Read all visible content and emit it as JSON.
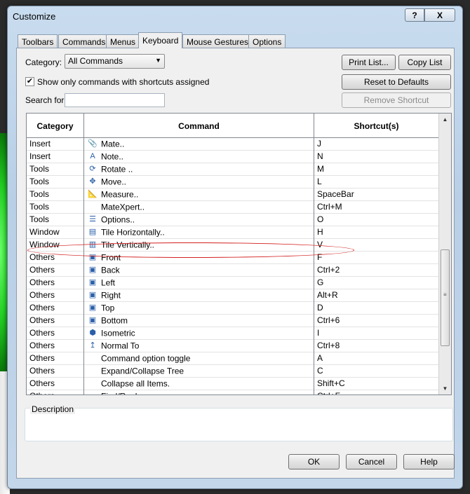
{
  "window": {
    "title": "Customize",
    "help_glyph": "?",
    "close_glyph": "X"
  },
  "tabs": [
    {
      "label": "Toolbars"
    },
    {
      "label": "Commands"
    },
    {
      "label": "Menus"
    },
    {
      "label": "Keyboard"
    },
    {
      "label": "Mouse Gestures"
    },
    {
      "label": "Options"
    }
  ],
  "active_tab": "Keyboard",
  "category": {
    "label": "Category:",
    "value": "All Commands"
  },
  "show_only": {
    "checked": true,
    "label": "Show only commands with shortcuts assigned"
  },
  "search": {
    "label": "Search for:",
    "value": ""
  },
  "buttons": {
    "print_list": "Print List...",
    "copy_list": "Copy List",
    "reset_defaults": "Reset to Defaults",
    "remove_shortcut": "Remove Shortcut",
    "ok": "OK",
    "cancel": "Cancel",
    "help": "Help"
  },
  "table": {
    "headers": [
      "Category",
      "Command",
      "Shortcut(s)"
    ],
    "rows": [
      {
        "category": "Insert",
        "icon": "paperclip-icon",
        "glyph": "📎",
        "command": "Mate..",
        "shortcut": "J"
      },
      {
        "category": "Insert",
        "icon": "note-icon",
        "glyph": "A",
        "command": "Note..",
        "shortcut": "N"
      },
      {
        "category": "Tools",
        "icon": "rotate-icon",
        "glyph": "⟳",
        "command": "Rotate ..",
        "shortcut": "M"
      },
      {
        "category": "Tools",
        "icon": "move-icon",
        "glyph": "✥",
        "command": "Move..",
        "shortcut": "L"
      },
      {
        "category": "Tools",
        "icon": "measure-icon",
        "glyph": "📐",
        "command": "Measure..",
        "shortcut": "SpaceBar"
      },
      {
        "category": "Tools",
        "icon": "",
        "glyph": "",
        "command": "MateXpert..",
        "shortcut": "Ctrl+M"
      },
      {
        "category": "Tools",
        "icon": "options-icon",
        "glyph": "☰",
        "command": "Options..",
        "shortcut": "O"
      },
      {
        "category": "Window",
        "icon": "tile-horizontal-icon",
        "glyph": "▤",
        "command": "Tile Horizontally..",
        "shortcut": "H"
      },
      {
        "category": "Window",
        "icon": "tile-vertical-icon",
        "glyph": "▥",
        "command": "Tile Vertically..",
        "shortcut": "V"
      },
      {
        "category": "Others",
        "icon": "front-view-icon",
        "glyph": "▣",
        "command": "Front",
        "shortcut": "F"
      },
      {
        "category": "Others",
        "icon": "back-view-icon",
        "glyph": "▣",
        "command": "Back",
        "shortcut": "Ctrl+2"
      },
      {
        "category": "Others",
        "icon": "left-view-icon",
        "glyph": "▣",
        "command": "Left",
        "shortcut": "G"
      },
      {
        "category": "Others",
        "icon": "right-view-icon",
        "glyph": "▣",
        "command": "Right",
        "shortcut": "Alt+R"
      },
      {
        "category": "Others",
        "icon": "top-view-icon",
        "glyph": "▣",
        "command": "Top",
        "shortcut": "D"
      },
      {
        "category": "Others",
        "icon": "bottom-view-icon",
        "glyph": "▣",
        "command": "Bottom",
        "shortcut": "Ctrl+6"
      },
      {
        "category": "Others",
        "icon": "isometric-view-icon",
        "glyph": "⬢",
        "command": "Isometric",
        "shortcut": "I"
      },
      {
        "category": "Others",
        "icon": "normal-to-icon",
        "glyph": "↥",
        "command": "Normal To",
        "shortcut": "Ctrl+8"
      },
      {
        "category": "Others",
        "icon": "",
        "glyph": "",
        "command": "Command option toggle",
        "shortcut": "A"
      },
      {
        "category": "Others",
        "icon": "",
        "glyph": "",
        "command": "Expand/Collapse Tree",
        "shortcut": "C"
      },
      {
        "category": "Others",
        "icon": "",
        "glyph": "",
        "command": "Collapse all Items.",
        "shortcut": "Shift+C"
      },
      {
        "category": "Others",
        "icon": "",
        "glyph": "",
        "command": "Find/Replace",
        "shortcut": "Ctrl+F"
      }
    ]
  },
  "scrollbar": {
    "up": "▲",
    "down": "▼"
  },
  "description": {
    "label": "Description",
    "value": ""
  },
  "colors": {
    "annotation_circle": "#d42020",
    "window_frame": "#c3d6ea"
  }
}
